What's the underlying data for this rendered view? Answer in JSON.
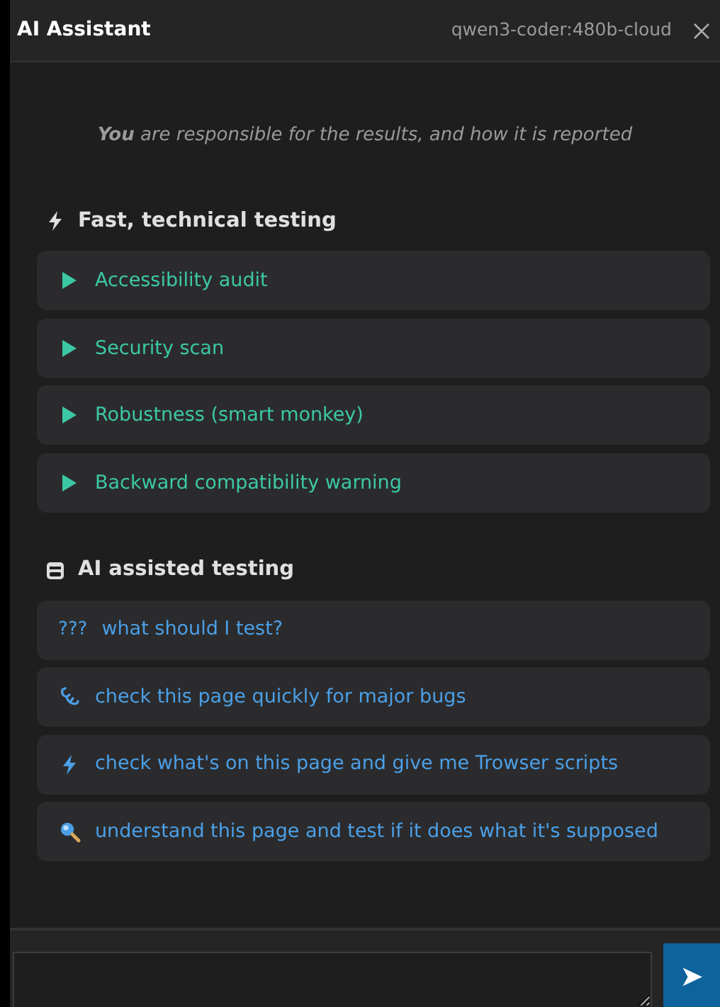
{
  "header": {
    "title": "AI Assistant",
    "model": "qwen3-coder:480b-cloud"
  },
  "disclaimer": "**You** are responsible for the results, and how it is reported",
  "sections": [
    {
      "title": "Fast, technical testing",
      "items": [
        {
          "label": "Accessibility audit"
        },
        {
          "label": "Security scan"
        },
        {
          "label": "Robustness (smart monkey)"
        },
        {
          "label": "Backward compatibility warning"
        }
      ]
    },
    {
      "title": "AI assisted testing",
      "items": [
        {
          "label": "what should I test?",
          "prefix": "???"
        },
        {
          "label": "check this page quickly for major bugs"
        },
        {
          "label": "check what's on this page and give me Trowser scripts"
        },
        {
          "label": "understand this page and test if it does what it's supposed"
        }
      ]
    }
  ],
  "composer": {
    "send": "➤"
  }
}
